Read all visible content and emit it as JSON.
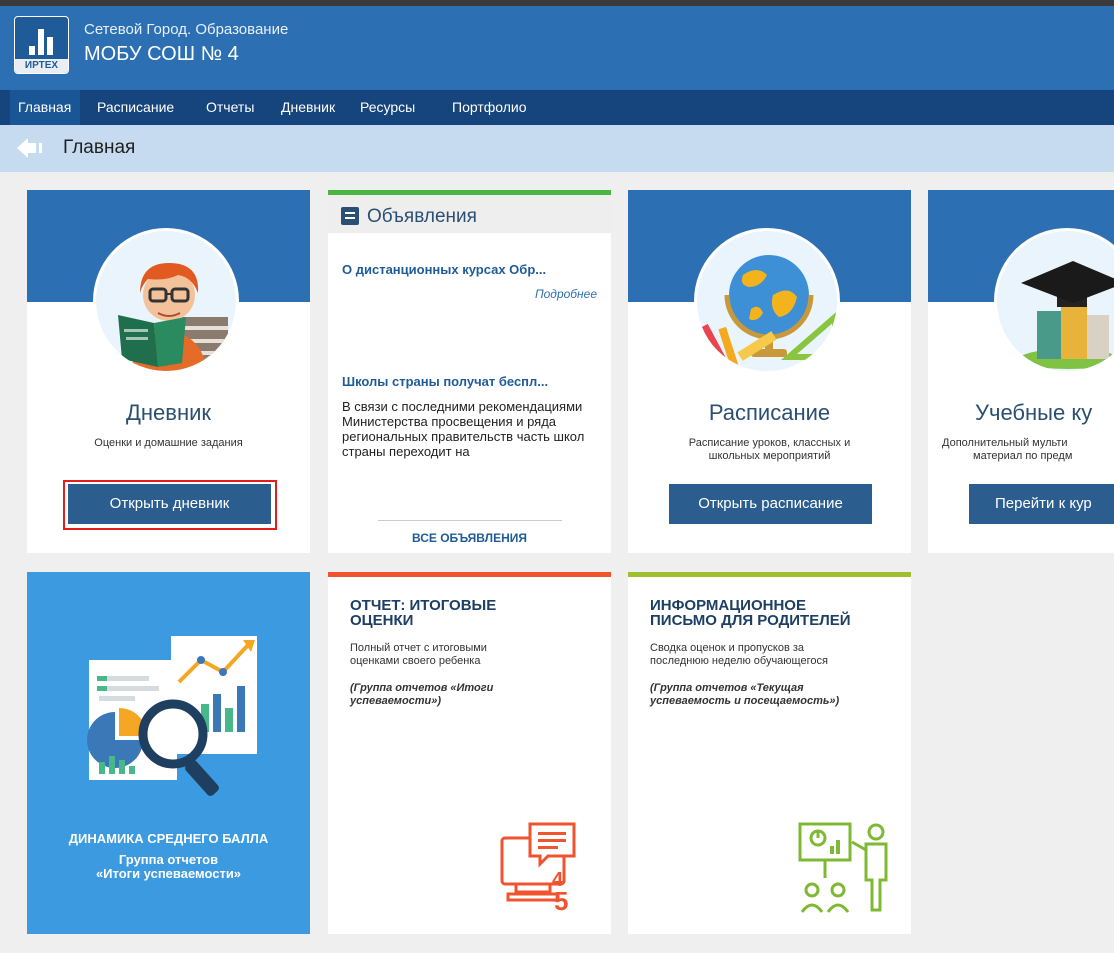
{
  "header": {
    "app_name": "Сетевой Город. Образование",
    "school_name": "МОБУ СОШ № 4",
    "logo_label": "ИРТЕХ"
  },
  "nav": {
    "items": [
      {
        "label": "Главная"
      },
      {
        "label": "Расписание"
      },
      {
        "label": "Отчеты"
      },
      {
        "label": "Дневник"
      },
      {
        "label": "Ресурсы"
      },
      {
        "label": "Портфолио"
      }
    ],
    "active_index": 0
  },
  "breadcrumb": {
    "title": "Главная"
  },
  "cards": {
    "diary": {
      "title": "Дневник",
      "subtitle": "Оценки и домашние задания",
      "button": "Открыть дневник"
    },
    "announcements": {
      "heading": "Объявления",
      "items": [
        {
          "title": "О дистанционных курсах Обр...",
          "more": "Подробнее"
        },
        {
          "title": "Школы страны получат беспл...",
          "body": "В связи с последними рекомендациями Министерства просвещения и ряда региональных правительств часть школ страны переходит на"
        }
      ],
      "all_link": "ВСЕ ОБЪЯВЛЕНИЯ"
    },
    "schedule": {
      "title": "Расписание",
      "subtitle_line1": "Расписание уроков, классных и",
      "subtitle_line2": "школьных мероприятий",
      "button": "Открыть расписание"
    },
    "courses": {
      "title": "Учебные ку",
      "subtitle_line1": "Дополнительный мульти",
      "subtitle_line2": "материал по предм",
      "button": "Перейти к кур"
    },
    "dynamics": {
      "title": "ДИНАМИКА СРЕДНЕГО БАЛЛА",
      "sub_line1": "Группа отчетов",
      "sub_line2": "«Итоги успеваемости»"
    },
    "final_grades": {
      "title_line1": "ОТЧЕТ: ИТОГОВЫЕ",
      "title_line2": "ОЦЕНКИ",
      "desc_line1": "Полный отчет с итоговыми",
      "desc_line2": "оценками своего ребенка",
      "group_line1": "(Группа отчетов «Итоги",
      "group_line2": "успеваемости»)",
      "accent": "#f0532e"
    },
    "info_letter": {
      "title_line1": "ИНФОРМАЦИОННОЕ",
      "title_line2": "ПИСЬМО ДЛЯ РОДИТЕЛЕЙ",
      "desc_line1": "Сводка оценок и пропусков за",
      "desc_line2": "последнюю неделю обучающегося",
      "group_line1": "(Группа отчетов «Текущая",
      "group_line2": "успеваемость и посещаемость»)",
      "accent": "#9fbf2e"
    }
  },
  "icons": {
    "back": "back-arrow-icon",
    "announcements": "document-list-icon",
    "chart": "chart-magnifier-icon",
    "grades": "computer-grades-icon",
    "teacher": "teacher-board-icon"
  },
  "colors": {
    "header_bg": "#2c70b3",
    "nav_bg": "#15457c",
    "breadcrumb_bg": "#c6dbf0",
    "button_bg": "#2b5d8f",
    "highlight_outline": "#e31c1c",
    "announcements_accent": "#4bb543"
  }
}
